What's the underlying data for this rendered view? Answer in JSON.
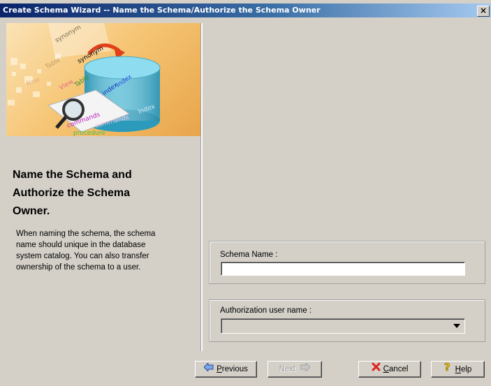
{
  "window": {
    "title": "Create Schema Wizard -- Name the Schema/Authorize the Schema Owner",
    "close_label": "✕"
  },
  "banner": {
    "words": [
      "synonym",
      "Table",
      "synonym",
      "View",
      "Table",
      "index",
      "Index",
      "New",
      "Index",
      "commands",
      "commands",
      "procedure"
    ]
  },
  "left": {
    "heading_line1": "Name the Schema and",
    "heading_line2": "Authorize the Schema",
    "heading_line3": "Owner.",
    "desc_line1": "When naming the schema, the schema",
    "desc_line2": "name should unique in the database",
    "desc_line3": "system catalog. You can also transfer",
    "desc_line4": "ownership of the schema to a user."
  },
  "form": {
    "schema_name_label": "Schema Name :",
    "schema_name_value": "",
    "auth_user_label": "Authorization user name :",
    "auth_user_value": ""
  },
  "buttons": {
    "previous_prefix": "",
    "previous_mnemonic": "P",
    "previous_rest": "revious",
    "next_label": "Next",
    "cancel_mnemonic": "C",
    "cancel_rest": "ancel",
    "help_mnemonic": "H",
    "help_rest": "elp"
  },
  "colors": {
    "title_start": "#0a246a",
    "title_end": "#a6caf0",
    "face": "#d4d0c8",
    "banner": "#f6c676"
  },
  "icons": [
    "close-icon",
    "back-arrow-icon",
    "forward-arrow-icon",
    "cancel-x-icon",
    "help-question-icon",
    "database-cylinder-icon",
    "magnifier-icon"
  ]
}
